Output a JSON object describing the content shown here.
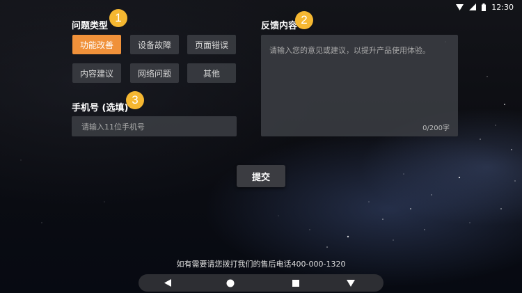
{
  "status_bar": {
    "time": "12:30"
  },
  "issue_type": {
    "label": "问题类型",
    "step": "1",
    "options": [
      {
        "label": "功能改善",
        "selected": true
      },
      {
        "label": "设备故障",
        "selected": false
      },
      {
        "label": "页面错误",
        "selected": false
      },
      {
        "label": "内容建议",
        "selected": false
      },
      {
        "label": "网络问题",
        "selected": false
      },
      {
        "label": "其他",
        "selected": false
      }
    ]
  },
  "phone": {
    "label": "手机号 (选填)",
    "step": "3",
    "placeholder": "请输入11位手机号"
  },
  "feedback": {
    "label": "反馈内容",
    "step": "2",
    "placeholder": "请输入您的意见或建议，以提升产品使用体验。",
    "counter": "0/200字"
  },
  "submit_label": "提交",
  "hotline_text": "如有需要请您拨打我们的售后电话400-000-1320",
  "colors": {
    "accent": "#f0913a",
    "badge": "#f5b731",
    "chip": "#3c3e44",
    "field": "#3c3e44"
  },
  "nav_icons": [
    "back-icon",
    "home-icon",
    "recents-icon",
    "dropdown-icon"
  ]
}
